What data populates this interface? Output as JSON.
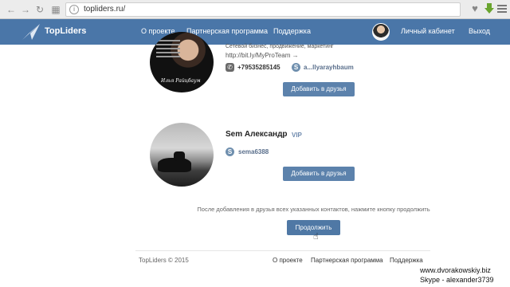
{
  "browser": {
    "url": "topliders.ru/"
  },
  "header": {
    "logo_text": "TopLiders",
    "nav": [
      "О проекте",
      "Партнерская программа",
      "Поддержка"
    ],
    "cabinet": "Личный кабинет",
    "logout": "Выход"
  },
  "card1": {
    "bio_text": "Сетевой бизнес, продвижение, маркетинг",
    "link": "http://bit.ly/MyProTeam →",
    "phone": "+79535285145",
    "skype": "a...llyarayhbaum",
    "signature": "Илья Райцбаум",
    "add_button": "Добавить в друзья"
  },
  "card2": {
    "name": "Sem Александр",
    "badge": "VIP",
    "skype": "sema6388",
    "add_button": "Добавить в друзья"
  },
  "hint": "После добавления в друзья всех указанных контактов, нажмите кнопку продолжить",
  "continue_button": "Продолжить",
  "footer": {
    "copyright": "TopLiders © 2015",
    "links": [
      "О проекте",
      "Партнерская программа",
      "Поддержка"
    ]
  },
  "watermark": {
    "line1": "www.dvorakowskiy.biz",
    "line2": "Skype - alexander3739"
  },
  "colors": {
    "header": "#4a76a8",
    "button": "#5c82ac"
  }
}
